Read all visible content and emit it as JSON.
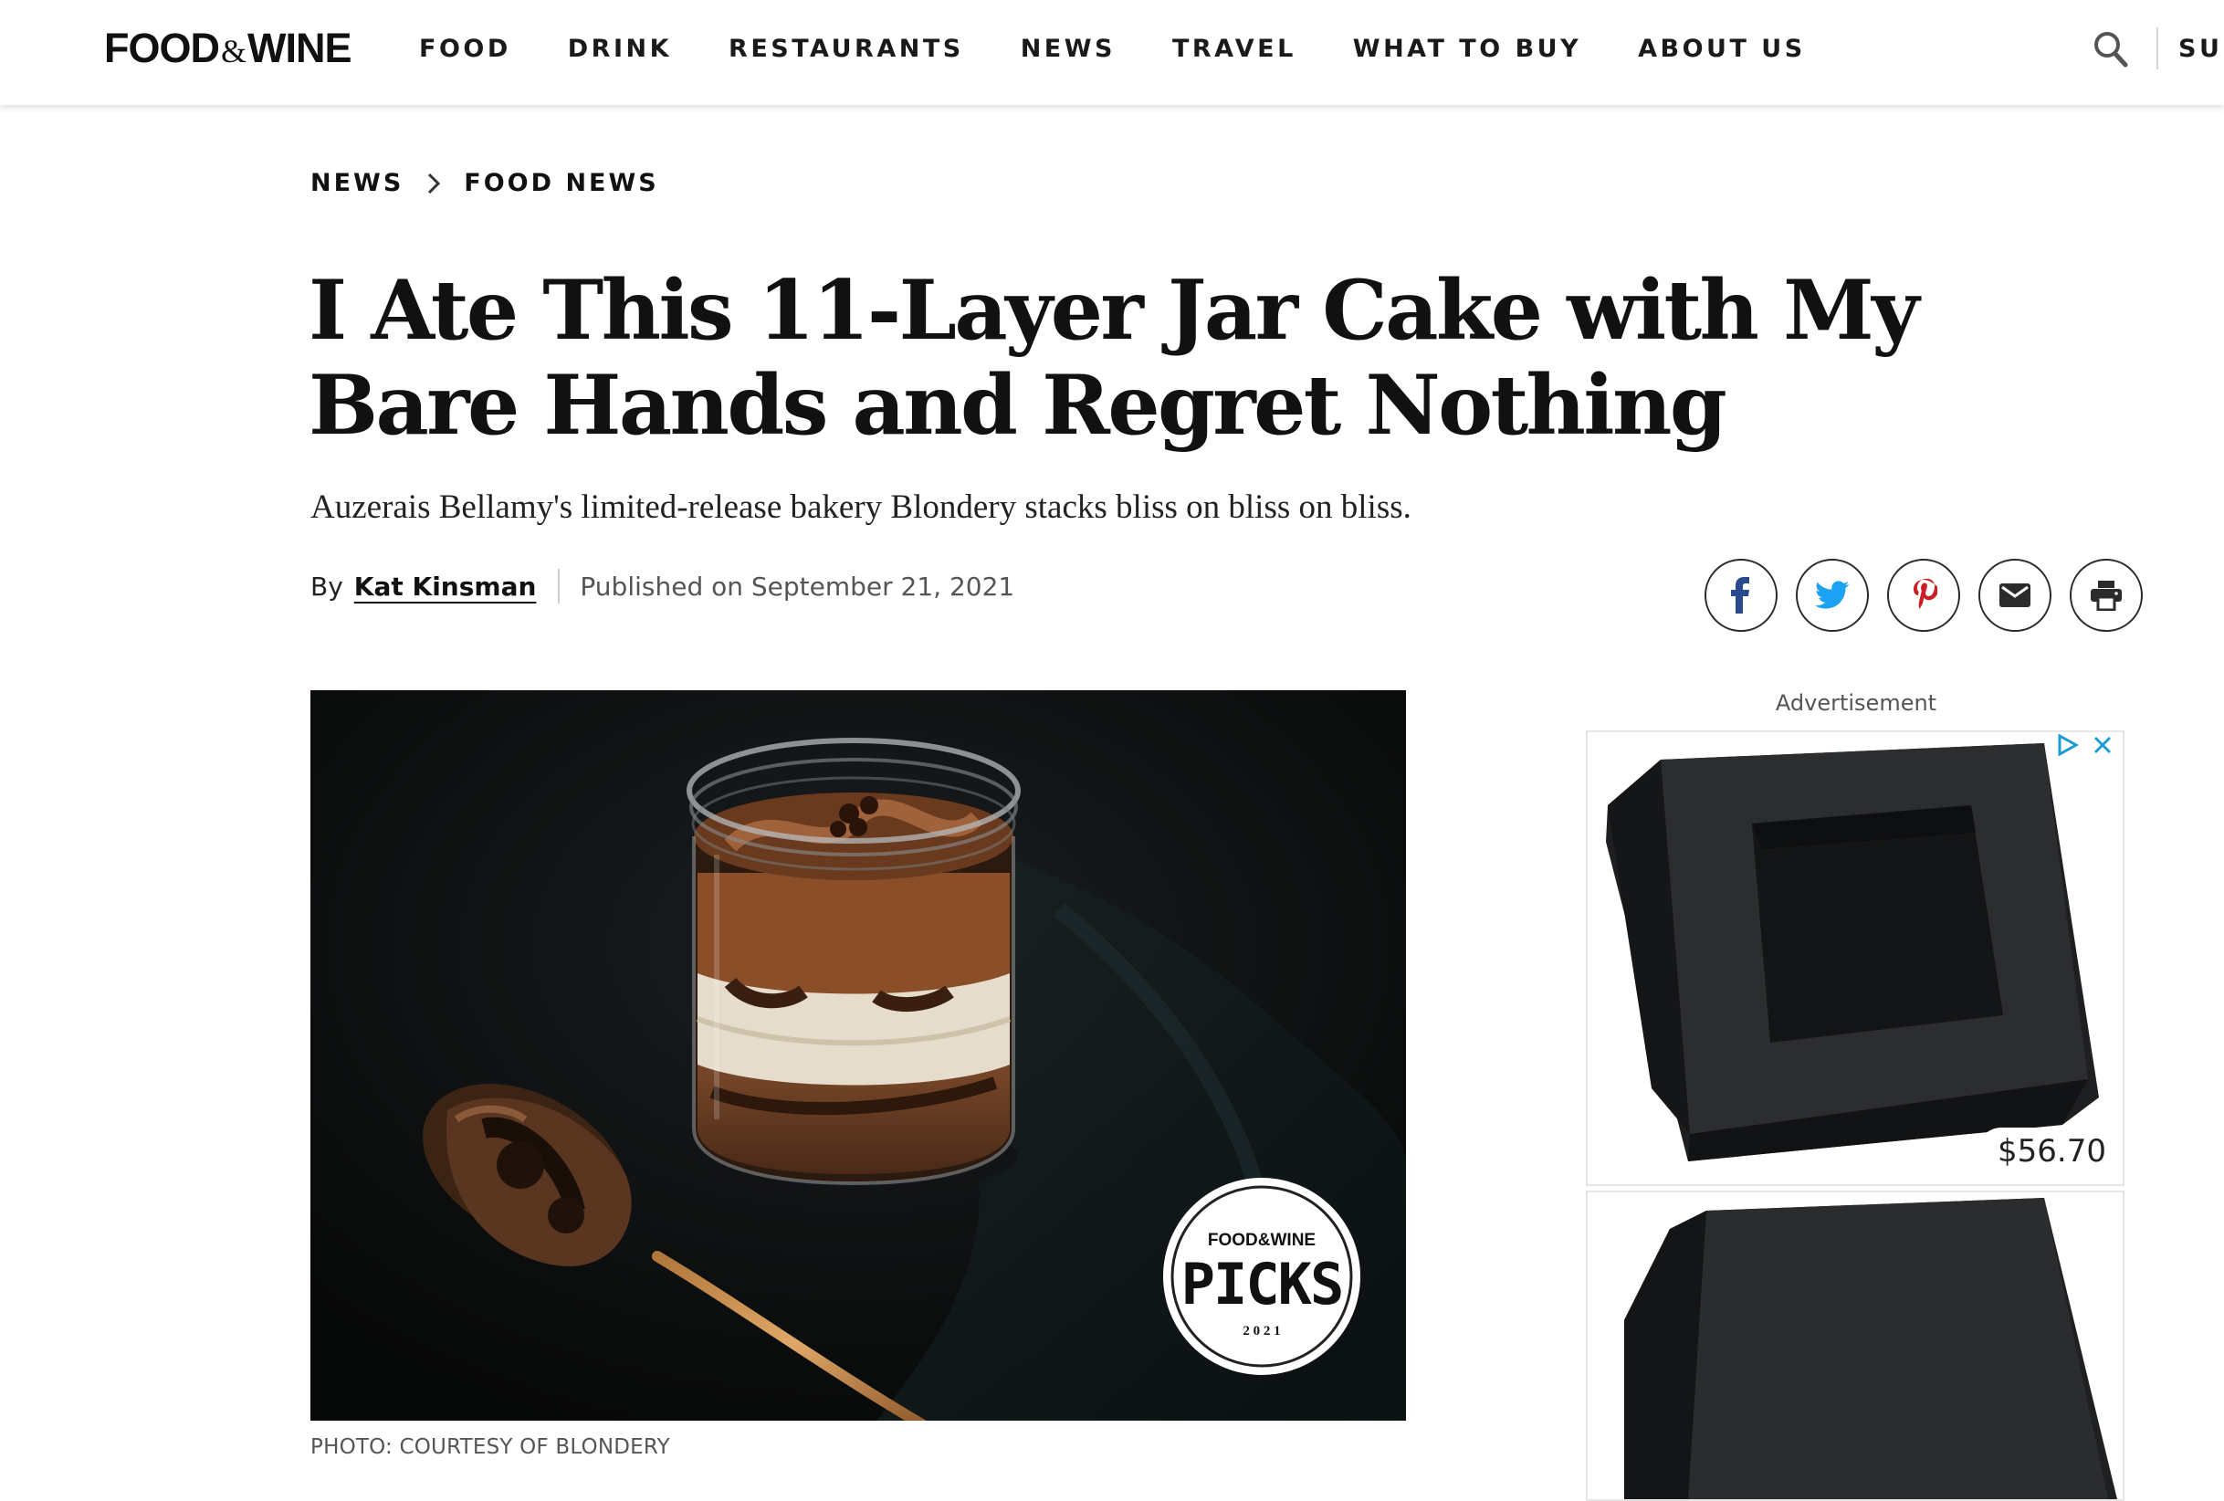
{
  "header": {
    "logo": {
      "left": "FOOD",
      "amp": "&",
      "right": "WINE"
    },
    "nav": [
      "FOOD",
      "DRINK",
      "RESTAURANTS",
      "NEWS",
      "TRAVEL",
      "WHAT TO BUY",
      "ABOUT US"
    ],
    "subscribe_partial": "SUB"
  },
  "breadcrumb": [
    "NEWS",
    "FOOD NEWS"
  ],
  "article": {
    "headline": "I Ate This 11-Layer Jar Cake with My Bare Hands and Regret Nothing",
    "dek": "Auzerais Bellamy's limited-release bakery Blondery stacks bliss on bliss on bliss.",
    "by_label": "By",
    "author": "Kat Kinsman",
    "published": "Published on September 21, 2021",
    "image_caption": "PHOTO: COURTESY OF BLONDERY",
    "badge": {
      "brand": "FOOD&WINE",
      "title": "PICKS",
      "year": "2 0 2 1"
    }
  },
  "share": [
    "facebook",
    "twitter",
    "pinterest",
    "email",
    "print"
  ],
  "ad": {
    "label": "Advertisement",
    "price": "$56.70"
  },
  "colors": {
    "text": "#111111",
    "twitter": "#1da1f2",
    "pinterest": "#cb1f27",
    "facebook": "#2a4a8e",
    "ad_choices": "#1a9bd7"
  }
}
